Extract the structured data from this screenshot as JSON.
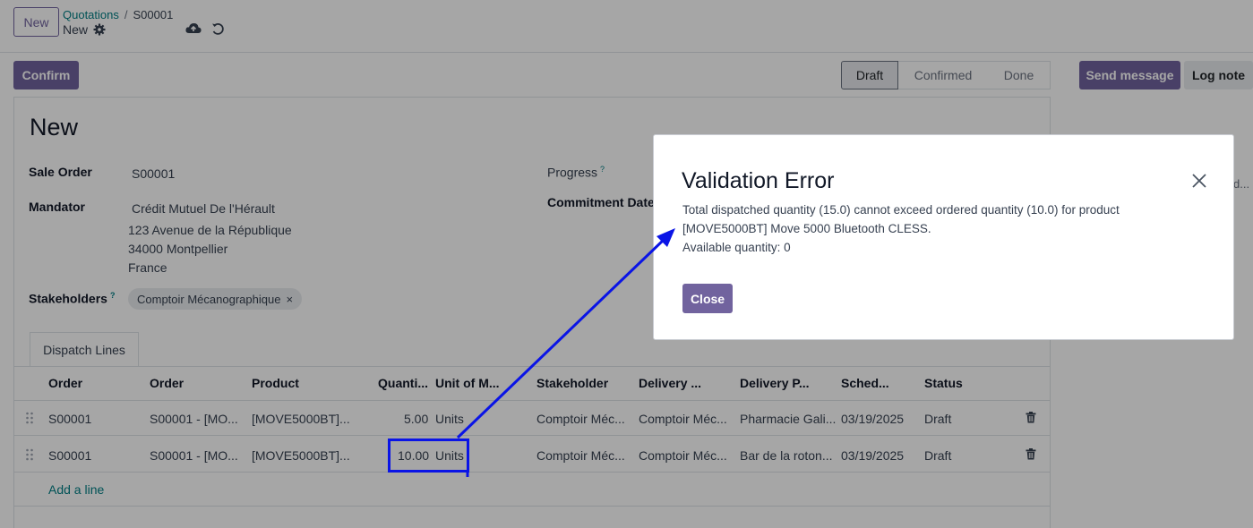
{
  "header": {
    "new_button": "New",
    "breadcrumb_parent": "Quotations",
    "breadcrumb_separator": "/",
    "breadcrumb_current": "S00001",
    "record_label": "New"
  },
  "actions": {
    "confirm": "Confirm",
    "send_message": "Send message",
    "log_note": "Log note"
  },
  "statusbar": {
    "stages": [
      "Draft",
      "Confirmed",
      "Done"
    ],
    "active": "Draft"
  },
  "form": {
    "title": "New",
    "sale_order_label": "Sale Order",
    "sale_order_value": "S00001",
    "mandator_label": "Mandator",
    "mandator_lines": [
      "Crédit Mutuel De l'Hérault",
      "123 Avenue de la République",
      "34000 Montpellier",
      "France"
    ],
    "stakeholders_label": "Stakeholders",
    "stakeholders_help": "?",
    "stakeholder_tag": "Comptoir Mécanographique",
    "stakeholder_tag_remove": "×",
    "progress_label": "Progress",
    "progress_help": "?",
    "commitment_label": "Commitment Date"
  },
  "tabs": {
    "dispatch_lines": "Dispatch Lines"
  },
  "table": {
    "columns": [
      "Order",
      "Order",
      "Product",
      "Quanti...",
      "Unit of M...",
      "Stakeholder",
      "Delivery ...",
      "Delivery P...",
      "Sched...",
      "Status"
    ],
    "rows": [
      [
        "S00001",
        "S00001 - [MO...",
        "[MOVE5000BT]...",
        "5.00",
        "Units",
        "Comptoir Méc...",
        "Comptoir Méc...",
        "Pharmacie Gali...",
        "03/19/2025",
        "Draft"
      ],
      [
        "S00001",
        "S00001 - [MO...",
        "[MOVE5000BT]...",
        "10.00",
        "Units",
        "Comptoir Méc...",
        "Comptoir Méc...",
        "Bar de la roton...",
        "03/19/2025",
        "Draft"
      ]
    ],
    "add_line": "Add a line"
  },
  "chatter": {
    "fragment": "d..."
  },
  "dialog": {
    "title": "Validation Error",
    "line1": "Total dispatched quantity (15.0) cannot exceed ordered quantity (10.0) for product",
    "line2": "[MOVE5000BT] Move 5000 Bluetooth CLESS.",
    "line3": "Available quantity: 0",
    "close_button": "Close"
  },
  "colors": {
    "brand": "#71639e",
    "annotation": "#0a14e6",
    "link": "#017e84"
  }
}
